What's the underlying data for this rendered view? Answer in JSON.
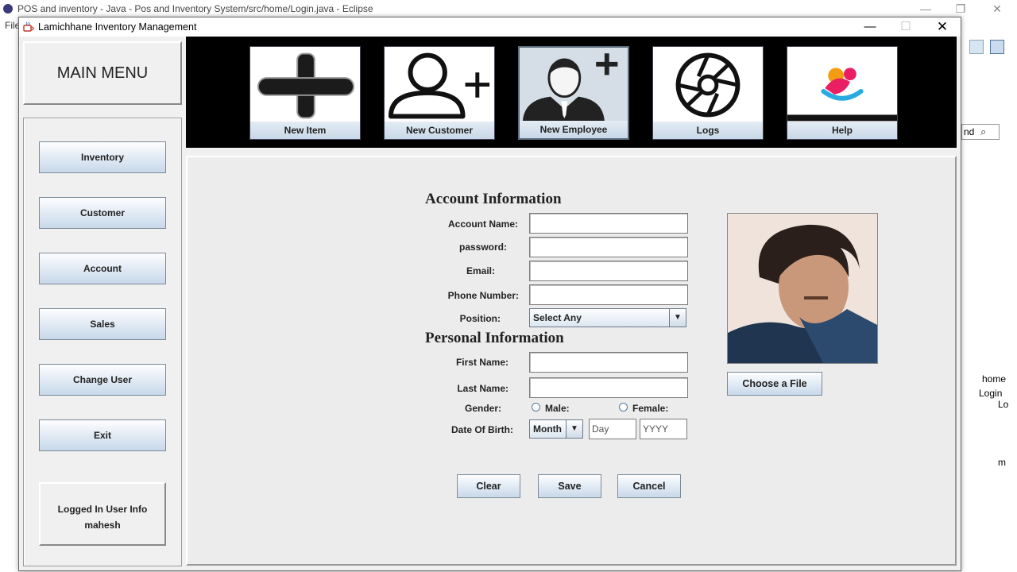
{
  "eclipse": {
    "title": "POS and inventory - Java - Pos and Inventory System/src/home/Login.java - Eclipse",
    "menu_first": "File",
    "search_text": "nd",
    "tree": [
      "home",
      "Login",
      "Lo",
      "m"
    ]
  },
  "window": {
    "title": "Lamichhane Inventory Management"
  },
  "sidebar": {
    "main_menu": "MAIN MENU",
    "items": [
      {
        "label": "Inventory"
      },
      {
        "label": "Customer"
      },
      {
        "label": "Account"
      },
      {
        "label": "Sales"
      },
      {
        "label": "Change User"
      },
      {
        "label": "Exit"
      }
    ],
    "logged_in_label": "Logged In User Info",
    "logged_in_user": "mahesh"
  },
  "toolbar": {
    "buttons": [
      {
        "label": "New Item",
        "icon": "plus-icon"
      },
      {
        "label": "New Customer",
        "icon": "add-user-icon"
      },
      {
        "label": "New Employee",
        "icon": "employee-icon"
      },
      {
        "label": "Logs",
        "icon": "camera-shutter-icon"
      },
      {
        "label": "Help",
        "icon": "help-icon"
      }
    ],
    "active": "New Employee"
  },
  "form": {
    "account_section": "Account Information",
    "personal_section": "Personal Information",
    "labels": {
      "account_name": "Account Name:",
      "password": "password:",
      "email": "Email:",
      "phone": "Phone Number:",
      "position": "Position:",
      "first_name": "First Name:",
      "last_name": "Last Name:",
      "gender": "Gender:",
      "dob": "Date Of Birth:"
    },
    "values": {
      "account_name": "",
      "password": "",
      "email": "",
      "phone": "",
      "first_name": "",
      "last_name": ""
    },
    "position_selected": "Select Any",
    "gender_options": {
      "male": "Male:",
      "female": "Female:"
    },
    "dob": {
      "month": "Month",
      "day": "Day",
      "year": "YYYY"
    },
    "choose_file": "Choose a File",
    "buttons": {
      "clear": "Clear",
      "save": "Save",
      "cancel": "Cancel"
    }
  }
}
